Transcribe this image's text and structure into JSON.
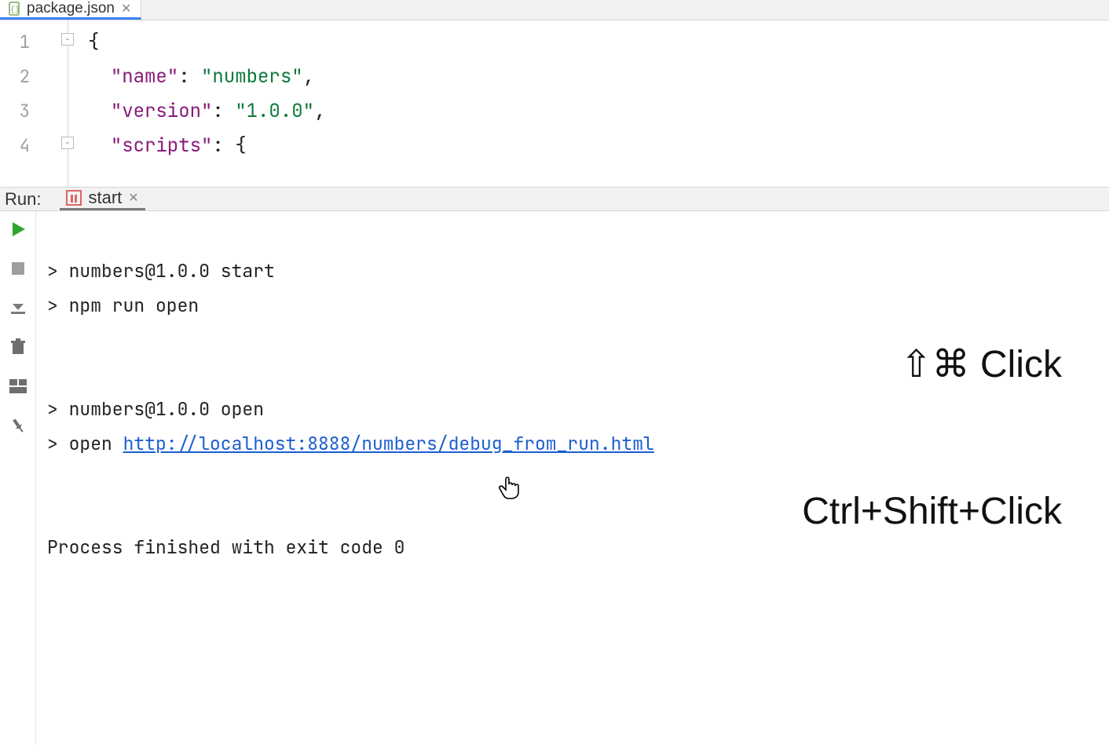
{
  "tabs": {
    "file": {
      "label": "package.json"
    }
  },
  "editor": {
    "lines": [
      "1",
      "2",
      "3",
      "4"
    ],
    "code": {
      "l1_brace": "{",
      "l2_key": "\"name\"",
      "l2_val": "\"numbers\"",
      "l3_key": "\"version\"",
      "l3_val": "\"1.0.0\"",
      "l4_key": "\"scripts\"",
      "l4_brace": "{"
    }
  },
  "runpanel": {
    "label": "Run:",
    "tab": "start"
  },
  "console": {
    "l1": "> numbers@1.0.0 start",
    "l2": "> npm run open",
    "l3": "",
    "l4": "",
    "l5": "> numbers@1.0.0 open",
    "l6_prefix": "> open ",
    "l6_link": "http://localhost:8888/numbers/debug_from_run.html",
    "l7": "",
    "l8": "",
    "l9": "Process finished with exit code 0"
  },
  "overlay": {
    "line1": "⇧⌘ Click",
    "line2": "Ctrl+Shift+Click"
  }
}
